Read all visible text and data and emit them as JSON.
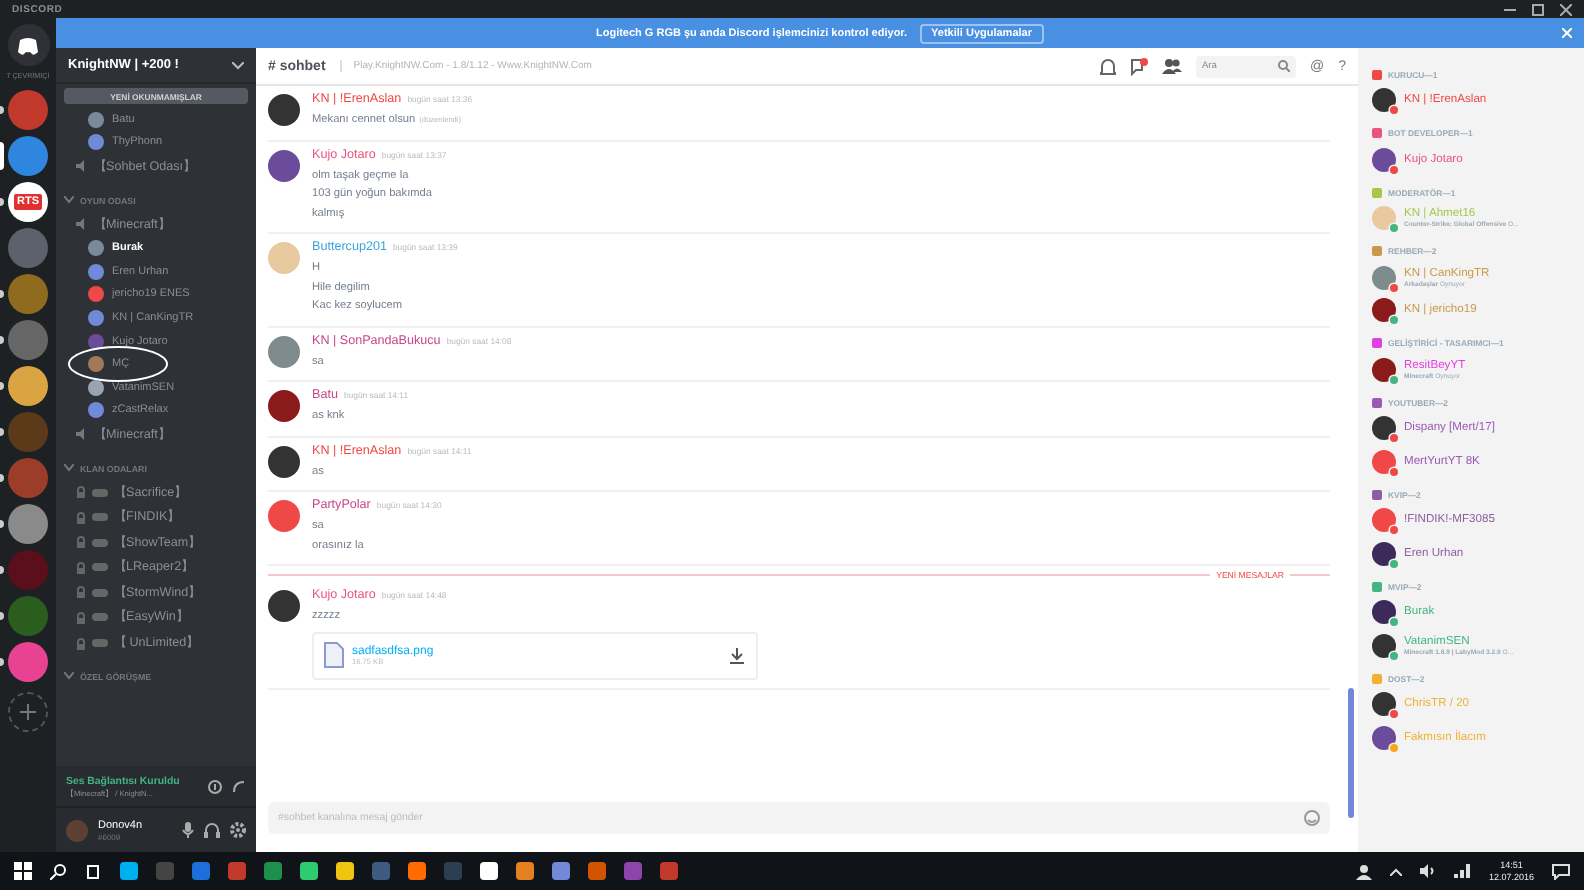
{
  "title_bar": {
    "title": "DISCORD"
  },
  "servers": {
    "online_label": "7 ÇEVRİMİÇİ",
    "items": [
      {
        "selected": false,
        "unread": true
      },
      {
        "selected": true
      },
      {
        "selected": false,
        "unread": true,
        "label": "RTS"
      },
      {
        "selected": false,
        "unread": false
      },
      {
        "selected": false,
        "unread": true
      },
      {
        "selected": false,
        "unread": true
      },
      {
        "selected": false,
        "unread": true
      },
      {
        "selected": false,
        "unread": true
      },
      {
        "selected": false,
        "unread": true
      },
      {
        "selected": false,
        "unread": true
      },
      {
        "selected": false,
        "unread": true
      },
      {
        "selected": false,
        "unread": true
      },
      {
        "selected": false,
        "unread": true
      }
    ]
  },
  "banner": {
    "text": "Logitech G RGB şu anda Discord işlemcinizi kontrol ediyor.",
    "button": "Yetkili Uygulamalar"
  },
  "guild": {
    "name": "KnightNW | +200 !",
    "unread_bar": "YENİ OKUNMAMIŞLAR"
  },
  "channels": {
    "items": [
      {
        "kind": "voice-user",
        "name": "Batu",
        "speaking": false,
        "circled": false
      },
      {
        "kind": "voice-user",
        "name": "ThyPhonn",
        "speaking": false,
        "circled": false
      },
      {
        "kind": "voice-channel",
        "name": "【Sohbet Odası】"
      },
      {
        "kind": "category",
        "name": "OYUN ODASI",
        "children": [
          {
            "kind": "voice-channel",
            "name": "【Minecraft】",
            "children": [
              {
                "name": "Burak",
                "speaking": true,
                "circled": false
              },
              {
                "name": "Eren Urhan",
                "speaking": false,
                "circled": false
              },
              {
                "name": "jericho19 ENES",
                "speaking": false,
                "circled": false
              },
              {
                "name": "KN | CanKingTR",
                "speaking": false,
                "circled": false
              },
              {
                "name": "Kujo Jotaro",
                "speaking": false,
                "circled": false
              },
              {
                "name": "MÇ",
                "speaking": false,
                "circled": true
              },
              {
                "name": "VatanimSEN",
                "speaking": false,
                "circled": false
              },
              {
                "name": "zCastRelax",
                "speaking": false,
                "circled": false
              }
            ]
          },
          {
            "kind": "voice-channel",
            "name": "【Minecraft】"
          }
        ]
      },
      {
        "kind": "category",
        "name": "KLAN ODALARI",
        "children": [
          {
            "kind": "locked-channel",
            "name": "【Sacrifice】"
          },
          {
            "kind": "locked-channel",
            "name": "【FINDIK】"
          },
          {
            "kind": "locked-channel",
            "name": "【ShowTeam】"
          },
          {
            "kind": "locked-channel",
            "name": "【LReaper2】"
          },
          {
            "kind": "locked-channel",
            "name": "【StormWind】"
          },
          {
            "kind": "locked-channel",
            "name": "【EasyWin】"
          },
          {
            "kind": "locked-channel",
            "name": "【 UnLimited】"
          }
        ]
      },
      {
        "kind": "category",
        "name": "ÖZEL GÖRÜŞME"
      }
    ]
  },
  "voice_status": {
    "status": "Ses Bağlantısı Kuruldu",
    "channel": "【Minecraft】 / KnightN..."
  },
  "user": {
    "name": "Donov4n",
    "tag": "#6009"
  },
  "chat": {
    "channel": "# sohbet",
    "topic": "Play.KnightNW.Com - 1.8/1.12 - Www.KnightNW.Com",
    "search_placeholder": "Ara",
    "mention": "@",
    "help": "?",
    "messages": [
      {
        "kind": "message",
        "author": "KN | !ErenAslan",
        "color": "#f04747",
        "time": "bugün saat 13:36",
        "lines": [
          "Mekanı cennet olsun"
        ],
        "edited": "(düzenlendi)"
      },
      {
        "kind": "message",
        "author": "Kujo Jotaro",
        "color": "#e9547d",
        "time": "bugün saat 13:37",
        "lines": [
          "olm taşak geçme la",
          "103 gün yoğun bakımda",
          "kalmış"
        ]
      },
      {
        "kind": "message",
        "author": "Buttercup201",
        "color": "#3ca4dc",
        "time": "bugün saat 13:39",
        "lines": [
          "H",
          "Hile degilim",
          "Kac kez soylucem"
        ]
      },
      {
        "kind": "message",
        "author": "KN | SonPandaBukucu",
        "color": "#c9458b",
        "time": "bugün saat 14:08",
        "lines": [
          "sa"
        ]
      },
      {
        "kind": "message",
        "author": "Batu",
        "color": "#c9458b",
        "time": "bugün saat 14:11",
        "lines": [
          "as knk"
        ]
      },
      {
        "kind": "message",
        "author": "KN | !ErenAslan",
        "color": "#f04747",
        "time": "bugün saat 14:11",
        "lines": [
          "as"
        ]
      },
      {
        "kind": "message",
        "author": "PartyPolar",
        "color": "#c9458b",
        "time": "bugün saat 14:30",
        "lines": [
          "sa",
          "orasınız la"
        ]
      },
      {
        "kind": "divider",
        "text": "YENİ MESAJLAR"
      },
      {
        "kind": "message",
        "author": "Kujo Jotaro",
        "color": "#e9547d",
        "time": "bugün saat 14:48",
        "lines": [
          "zzzzz"
        ],
        "attachment": {
          "file": "sadfasdfsa.png",
          "size": "16.75 KB"
        }
      }
    ],
    "input_placeholder": "#sohbet kanalına mesaj gönder"
  },
  "members": {
    "groups": [
      {
        "title": "KURUCU—1",
        "color": "#f04747",
        "members": [
          {
            "name": "KN | !ErenAslan",
            "color": "#f04747"
          }
        ]
      },
      {
        "title": "BOT DEVELOPER—1",
        "color": "#e9547d",
        "members": [
          {
            "name": "Kujo Jotaro",
            "color": "#f04747"
          }
        ]
      },
      {
        "title": "MODERATÖR—1",
        "color": "#a5c84a",
        "members": [
          {
            "name": "KN | Ahmet16",
            "color": "#43b581",
            "activity": "**Counter-Strike: Global Offensive** O..."
          }
        ]
      },
      {
        "title": "REHBER—2",
        "color": "#c99a4a",
        "members": [
          {
            "name": "KN | CanKingTR",
            "color": "#f04747",
            "activity": "**Arkadaşlar** Oynuyor"
          },
          {
            "name": "KN | jericho19",
            "color": "#43b581"
          }
        ]
      },
      {
        "title": "GELİŞTİRİCİ - TASARIMCI—1",
        "color": "#e040e0",
        "members": [
          {
            "name": "ResitBeyYT",
            "color": "#43b581",
            "activity": "**Minecraft** Oynuyor"
          }
        ]
      },
      {
        "title": "YOUTUBER—2",
        "color": "#9b59b6",
        "members": [
          {
            "name": "Dispany [Mert/17]",
            "color": "#f04747"
          },
          {
            "name": "MertYurtYT 8K",
            "color": "#f04747"
          }
        ]
      },
      {
        "title": "KVIP—2",
        "color": "#8e5ea2",
        "members": [
          {
            "name": "!FINDIK!-MF3085",
            "color": "#f04747"
          },
          {
            "name": "Eren Urhan",
            "color": "#43b581"
          }
        ]
      },
      {
        "title": "MVIP—2",
        "color": "#43b581",
        "members": [
          {
            "name": "Burak",
            "color": "#43b581"
          },
          {
            "name": "VatanimSEN",
            "color": "#43b581",
            "activity": "**Minecraft 1.8.9 | LabyMod 3.2.9** O..."
          }
        ]
      },
      {
        "title": "DOST—2",
        "color": "#f0b132",
        "members": [
          {
            "name": "ChrisTR / 20",
            "color": "#f04747"
          },
          {
            "name": "Fakmısın İlacım",
            "color": "#faa61a"
          }
        ]
      }
    ]
  },
  "taskbar": {
    "time": "14:51",
    "date": "12.07.2016"
  }
}
